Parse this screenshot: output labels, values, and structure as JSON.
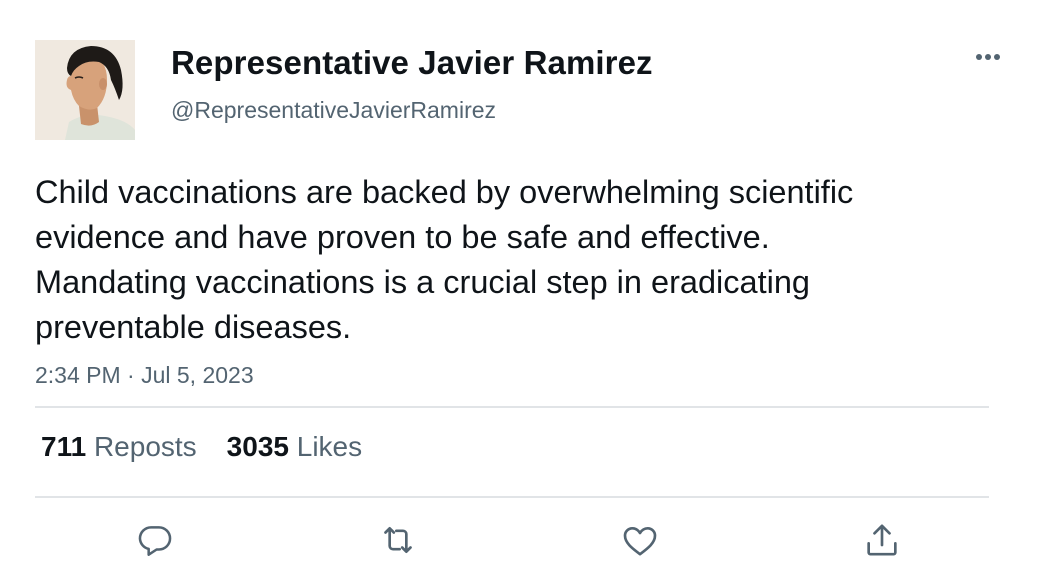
{
  "author": {
    "display_name": "Representative Javier Ramirez",
    "handle": "@RepresentativeJavierRamirez"
  },
  "tweet": {
    "text": "Child vaccinations are backed by overwhelming scientific evidence and have proven to be safe and effective. Mandating vaccinations is a crucial step in eradicating preventable diseases.",
    "timestamp": "2:34 PM · Jul 5, 2023"
  },
  "stats": {
    "reposts_count": "711",
    "reposts_label": "Reposts",
    "likes_count": "3035",
    "likes_label": "Likes"
  },
  "actions": [
    "reply-icon",
    "repost-icon",
    "like-icon",
    "share-icon"
  ],
  "colors": {
    "primary_text": "#0f1419",
    "secondary_text": "#536471",
    "divider": "#e1e4e7"
  }
}
